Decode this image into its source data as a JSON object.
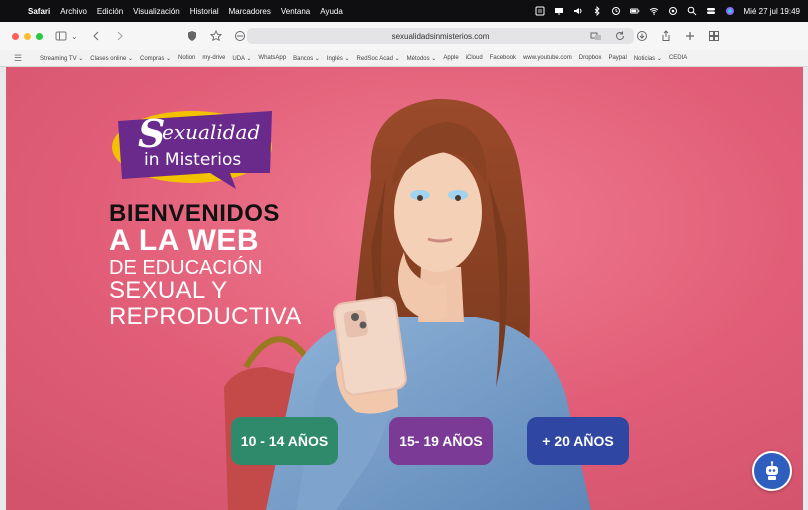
{
  "menubar": {
    "app": "Safari",
    "menus": [
      "Archivo",
      "Edición",
      "Visualización",
      "Historial",
      "Marcadores",
      "Ventana",
      "Ayuda"
    ],
    "clock": "Mié 27 jul  19:49"
  },
  "toolbar": {
    "url": "sexualidadsinmisterios.com"
  },
  "bookmarks": [
    "Streaming TV ⌄",
    "Clases online ⌄",
    "Compras ⌄",
    "Notion",
    "my-drive",
    "UDA ⌄",
    "WhatsApp",
    "Bancos ⌄",
    "Inglés ⌄",
    "RedSoc Acad ⌄",
    "Métodos ⌄",
    "Apple",
    "iCloud",
    "Facebook",
    "www.youtube.com",
    "Dropbox",
    "Paypal",
    "Noticias ⌄",
    "CEDIA"
  ],
  "page": {
    "logo_line1": "exualidad",
    "logo_s": "S",
    "logo_line2": "in Misterios",
    "headline": {
      "line1": "BIENVENIDOS",
      "line2": "A LA WEB",
      "line3": "DE EDUCACIÓN",
      "line4": "SEXUAL Y",
      "line5": "REPRODUCTIVA"
    },
    "buttons": {
      "age1": "10 - 14 AÑOS",
      "age2": "15- 19 AÑOS",
      "age3": "+ 20 AÑOS"
    },
    "colors": {
      "background": "#e35f78",
      "age1": "#2e8a6b",
      "age2": "#7a3a96",
      "age3": "#2f46a3",
      "logo_purple": "#6a2a8c",
      "logo_yellow": "#f2c200"
    }
  }
}
